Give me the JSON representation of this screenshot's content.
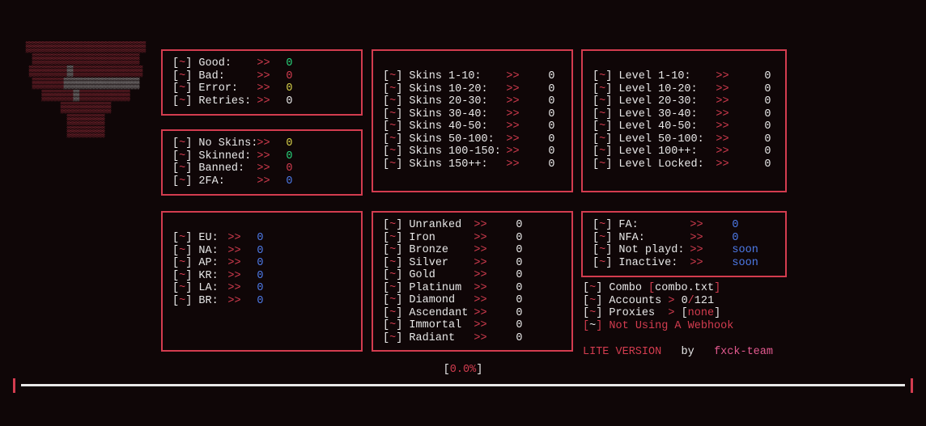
{
  "banner_rows": [
    "RRRRRRRRRRRRRRRRRRR",
    "RRRRRRRRRRRRRRRRR",
    "RRRRRRWRRRRRRRRRRR",
    "RRRRRWWWWWWWWWWWW",
    "RRRRRWRRRRRRRR",
    "RRRRRRRR",
    "RRRRRR",
    "RRRRRR"
  ],
  "status": [
    {
      "label": "Good:",
      "value": "0",
      "color": "c-green"
    },
    {
      "label": "Bad:",
      "value": "0",
      "color": "c-red"
    },
    {
      "label": "Error:",
      "value": "0",
      "color": "c-yellow"
    },
    {
      "label": "Retries:",
      "value": "0",
      "color": "c-white"
    }
  ],
  "status2": [
    {
      "label": "No Skins:",
      "value": "0",
      "color": "c-yellow"
    },
    {
      "label": "Skinned:",
      "value": "0",
      "color": "c-green"
    },
    {
      "label": "Banned:",
      "value": "0",
      "color": "c-red"
    },
    {
      "label": "2FA:",
      "value": "0",
      "color": "c-blue"
    }
  ],
  "skins": [
    {
      "label": "Skins 1-10:",
      "value": "0",
      "color": "c-white"
    },
    {
      "label": "Skins 10-20:",
      "value": "0",
      "color": "c-white"
    },
    {
      "label": "Skins 20-30:",
      "value": "0",
      "color": "c-white"
    },
    {
      "label": "Skins 30-40:",
      "value": "0",
      "color": "c-white"
    },
    {
      "label": "Skins 40-50:",
      "value": "0",
      "color": "c-white"
    },
    {
      "label": "Skins 50-100:",
      "value": "0",
      "color": "c-white"
    },
    {
      "label": "Skins 100-150:",
      "value": "0",
      "color": "c-white"
    },
    {
      "label": "Skins 150++:",
      "value": "0",
      "color": "c-white"
    }
  ],
  "levels": [
    {
      "label": "Level 1-10:",
      "value": "0",
      "color": "c-white"
    },
    {
      "label": "Level 10-20:",
      "value": "0",
      "color": "c-white"
    },
    {
      "label": "Level 20-30:",
      "value": "0",
      "color": "c-white"
    },
    {
      "label": "Level 30-40:",
      "value": "0",
      "color": "c-white"
    },
    {
      "label": "Level 40-50:",
      "value": "0",
      "color": "c-white"
    },
    {
      "label": "Level 50-100:",
      "value": "0",
      "color": "c-white"
    },
    {
      "label": "Level 100++:",
      "value": "0",
      "color": "c-white"
    },
    {
      "label": "Level Locked:",
      "value": "0",
      "color": "c-white"
    }
  ],
  "regions": [
    {
      "label": "EU:",
      "value": "0",
      "color": "c-blue"
    },
    {
      "label": "NA:",
      "value": "0",
      "color": "c-blue"
    },
    {
      "label": "AP:",
      "value": "0",
      "color": "c-blue"
    },
    {
      "label": "KR:",
      "value": "0",
      "color": "c-blue"
    },
    {
      "label": "LA:",
      "value": "0",
      "color": "c-blue"
    },
    {
      "label": "BR:",
      "value": "0",
      "color": "c-blue"
    }
  ],
  "ranks": [
    {
      "label": "Unranked",
      "value": "0",
      "color": "c-white"
    },
    {
      "label": "Iron",
      "value": "0",
      "color": "c-white"
    },
    {
      "label": "Bronze",
      "value": "0",
      "color": "c-white"
    },
    {
      "label": "Silver",
      "value": "0",
      "color": "c-white"
    },
    {
      "label": "Gold",
      "value": "0",
      "color": "c-white"
    },
    {
      "label": "Platinum",
      "value": "0",
      "color": "c-white"
    },
    {
      "label": "Diamond",
      "value": "0",
      "color": "c-white"
    },
    {
      "label": "Ascendant",
      "value": "0",
      "color": "c-white"
    },
    {
      "label": "Immortal",
      "value": "0",
      "color": "c-white"
    },
    {
      "label": "Radiant",
      "value": "0",
      "color": "c-white"
    }
  ],
  "fa": [
    {
      "label": "FA:",
      "value": "0",
      "color": "c-blue"
    },
    {
      "label": "NFA:",
      "value": "0",
      "color": "c-blue"
    },
    {
      "label": "Not playd:",
      "value": "soon",
      "color": "c-blue"
    },
    {
      "label": "Inactive:",
      "value": "soon",
      "color": "c-blue"
    }
  ],
  "info": {
    "combo_label": "Combo",
    "combo_file": "combo.txt",
    "accounts_label": "Accounts",
    "accounts_done": "0",
    "accounts_total": "121",
    "proxies_label": "Proxies",
    "proxies_value": "none",
    "webhook_text": "Not Using A Webhook"
  },
  "version": {
    "prefix": "LITE VERSION",
    "by": "by",
    "team": "fxck-team"
  },
  "progress": {
    "percent_text": "0.0"
  },
  "widths": {
    "status_label": 72,
    "status_arrowcol": 108,
    "skins_label": 120,
    "skins_arrowcol": 172,
    "levels_label": 120,
    "levels_arrowcol": 180,
    "regions_label": 36,
    "regions_arrowcol": 72,
    "ranks_label": 80,
    "ranks_arrowcol": 132,
    "fa_label": 88,
    "fa_arrowcol": 140
  }
}
